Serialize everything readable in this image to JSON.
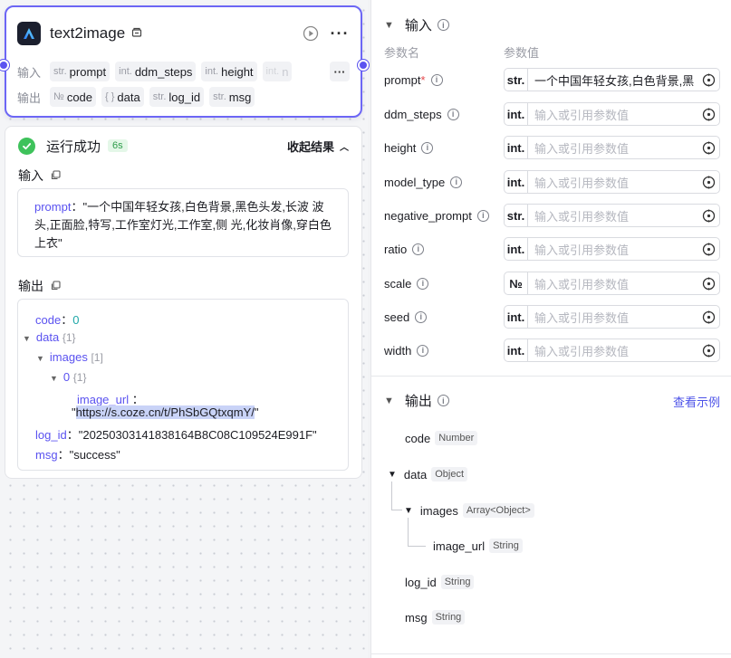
{
  "node": {
    "title": "text2image",
    "input_label": "输入",
    "output_label": "输出",
    "inputs": [
      {
        "type": "str.",
        "name": "prompt"
      },
      {
        "type": "int.",
        "name": "ddm_steps"
      },
      {
        "type": "int.",
        "name": "height"
      },
      {
        "type": "int.",
        "name": "n"
      }
    ],
    "outputs": [
      {
        "type": "№",
        "name": "code"
      },
      {
        "type": "{ }",
        "name": "data"
      },
      {
        "type": "str.",
        "name": "log_id"
      },
      {
        "type": "str.",
        "name": "msg"
      }
    ]
  },
  "result": {
    "status": "运行成功",
    "time": "6s",
    "collapse_label": "收起结果",
    "input_label": "输入",
    "output_label": "输出",
    "input_key": "prompt",
    "input_colon": "：",
    "input_value_1": "\"一个中国年轻女孩,白色背景,黑色头发,长波 波",
    "input_value_2": "头,正面脸,特写,工作室灯光,工作室,侧 光,化妆肖像,穿白色",
    "input_value_3": "上衣\"",
    "output": {
      "code_key": "code",
      "code_value": "0",
      "data_key": "data",
      "data_meta": "{1}",
      "images_key": "images",
      "images_meta": "[1]",
      "idx_key": "0",
      "idx_meta": "{1}",
      "image_url_key": "image_url",
      "image_url_quote_open": "\"",
      "image_url_value": "https://s.coze.cn/t/PhSbGQtxqmY/",
      "image_url_quote_close": "\"",
      "log_id_key": "log_id",
      "log_id_value": "\"20250303141838164B8C08C109524E991F\"",
      "msg_key": "msg",
      "msg_value": "\"success\""
    }
  },
  "panel": {
    "input_title": "输入",
    "col_name": "参数名",
    "col_value": "参数值",
    "params": [
      {
        "name": "prompt",
        "required": true,
        "type": "str.",
        "value": "一个中国年轻女孩,白色背景,黑",
        "filled": true
      },
      {
        "name": "ddm_steps",
        "required": false,
        "type": "int.",
        "value": "输入或引用参数值",
        "filled": false
      },
      {
        "name": "height",
        "required": false,
        "type": "int.",
        "value": "输入或引用参数值",
        "filled": false
      },
      {
        "name": "model_type",
        "required": false,
        "type": "int.",
        "value": "输入或引用参数值",
        "filled": false
      },
      {
        "name": "negative_prompt",
        "required": false,
        "type": "str.",
        "value": "输入或引用参数值",
        "filled": false
      },
      {
        "name": "ratio",
        "required": false,
        "type": "int.",
        "value": "输入或引用参数值",
        "filled": false
      },
      {
        "name": "scale",
        "required": false,
        "type": "№",
        "value": "输入或引用参数值",
        "filled": false
      },
      {
        "name": "seed",
        "required": false,
        "type": "int.",
        "value": "输入或引用参数值",
        "filled": false
      },
      {
        "name": "width",
        "required": false,
        "type": "int.",
        "value": "输入或引用参数值",
        "filled": false
      }
    ],
    "output_title": "输出",
    "example_link": "查看示例",
    "outputs": [
      {
        "name": "code",
        "type": "Number"
      },
      {
        "name": "data",
        "type": "Object"
      },
      {
        "name": "images",
        "type": "Array<Object>"
      },
      {
        "name": "image_url",
        "type": "String"
      },
      {
        "name": "log_id",
        "type": "String"
      },
      {
        "name": "msg",
        "type": "String"
      }
    ]
  }
}
